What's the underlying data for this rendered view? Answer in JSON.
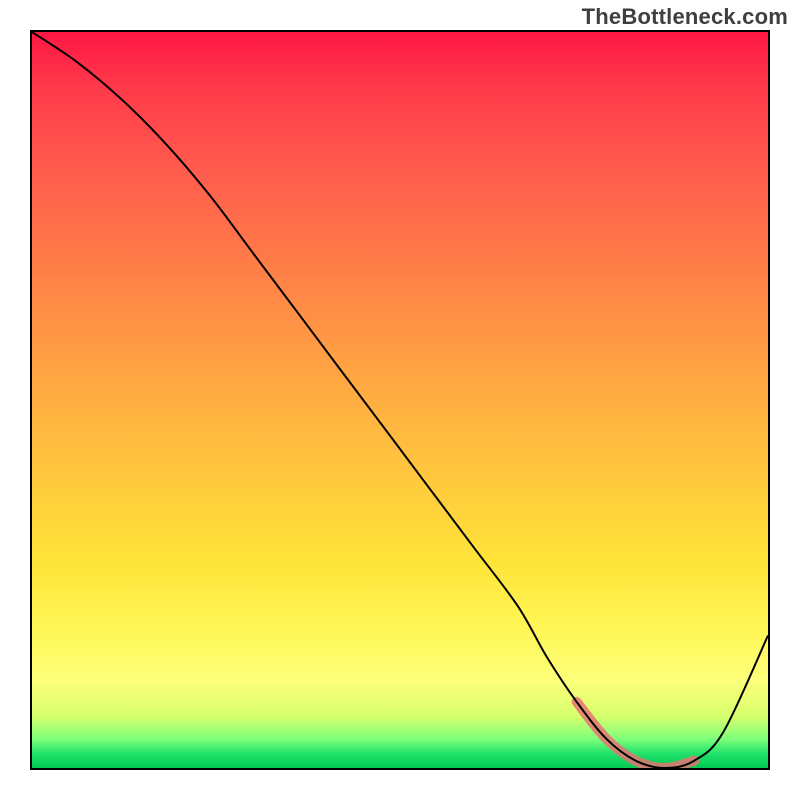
{
  "watermark": "TheBottleneck.com",
  "chart_data": {
    "type": "line",
    "title": "",
    "xlabel": "",
    "ylabel": "",
    "xlim": [
      0,
      100
    ],
    "ylim": [
      0,
      100
    ],
    "grid": false,
    "series": [
      {
        "name": "bottleneck-curve",
        "x": [
          0,
          6,
          12,
          18,
          24,
          30,
          36,
          42,
          48,
          54,
          60,
          66,
          70,
          74,
          78,
          82,
          86,
          90,
          94,
          100
        ],
        "values": [
          100,
          96,
          91,
          85,
          78,
          70,
          62,
          54,
          46,
          38,
          30,
          22,
          15,
          9,
          4,
          1,
          0,
          1,
          5,
          18
        ]
      }
    ],
    "annotations": [
      {
        "name": "optimal-range-highlight",
        "x_start": 74,
        "x_end": 92,
        "y_approx": 2
      }
    ],
    "background_gradient_stops": [
      {
        "pos": 0.0,
        "color": "#ff1744"
      },
      {
        "pos": 0.45,
        "color": "#ffa143"
      },
      {
        "pos": 0.82,
        "color": "#fff85a"
      },
      {
        "pos": 1.0,
        "color": "#00c853"
      }
    ]
  }
}
